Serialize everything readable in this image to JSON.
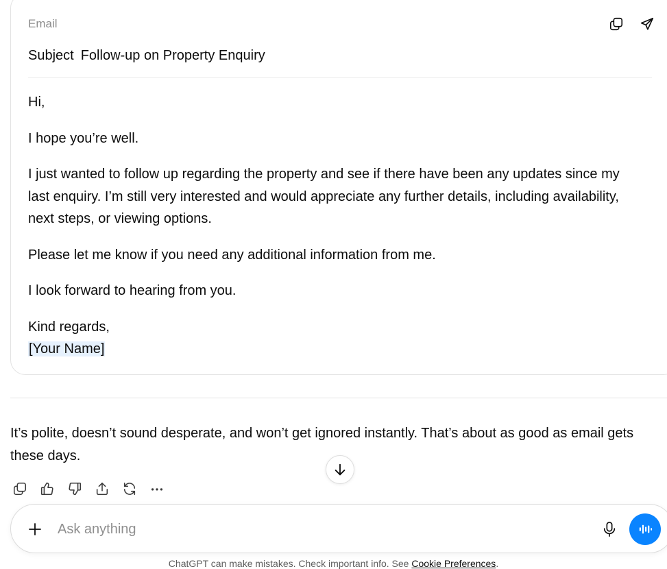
{
  "email": {
    "label": "Email",
    "subject_label": "Subject",
    "subject": "Follow-up on Property Enquiry",
    "paragraphs": [
      "Hi,",
      "I hope you’re well.",
      "I just wanted to follow up regarding the property and see if there have been any updates since my last enquiry. I’m still very interested and would appreciate any further details, including availability, next steps, or viewing options.",
      "Please let me know if you need any additional information from me.",
      "I look forward to hearing from you.",
      "Kind regards,",
      "[Your Name]"
    ],
    "icons": {
      "copy": "copy-icon",
      "send": "send-icon"
    }
  },
  "reply": {
    "text": "It’s polite, doesn’t sound desperate, and won’t get ignored instantly. That’s about as good as email gets these days."
  },
  "actions": [
    "copy-icon",
    "thumbs-up-icon",
    "thumbs-down-icon",
    "share-icon",
    "regenerate-icon",
    "more-icon"
  ],
  "composer": {
    "placeholder": "Ask anything",
    "accent_color": "#0a84ff"
  },
  "footer": {
    "disclaimer": "ChatGPT can make mistakes. Check important info. See ",
    "link": "Cookie Preferences",
    "end": "."
  }
}
